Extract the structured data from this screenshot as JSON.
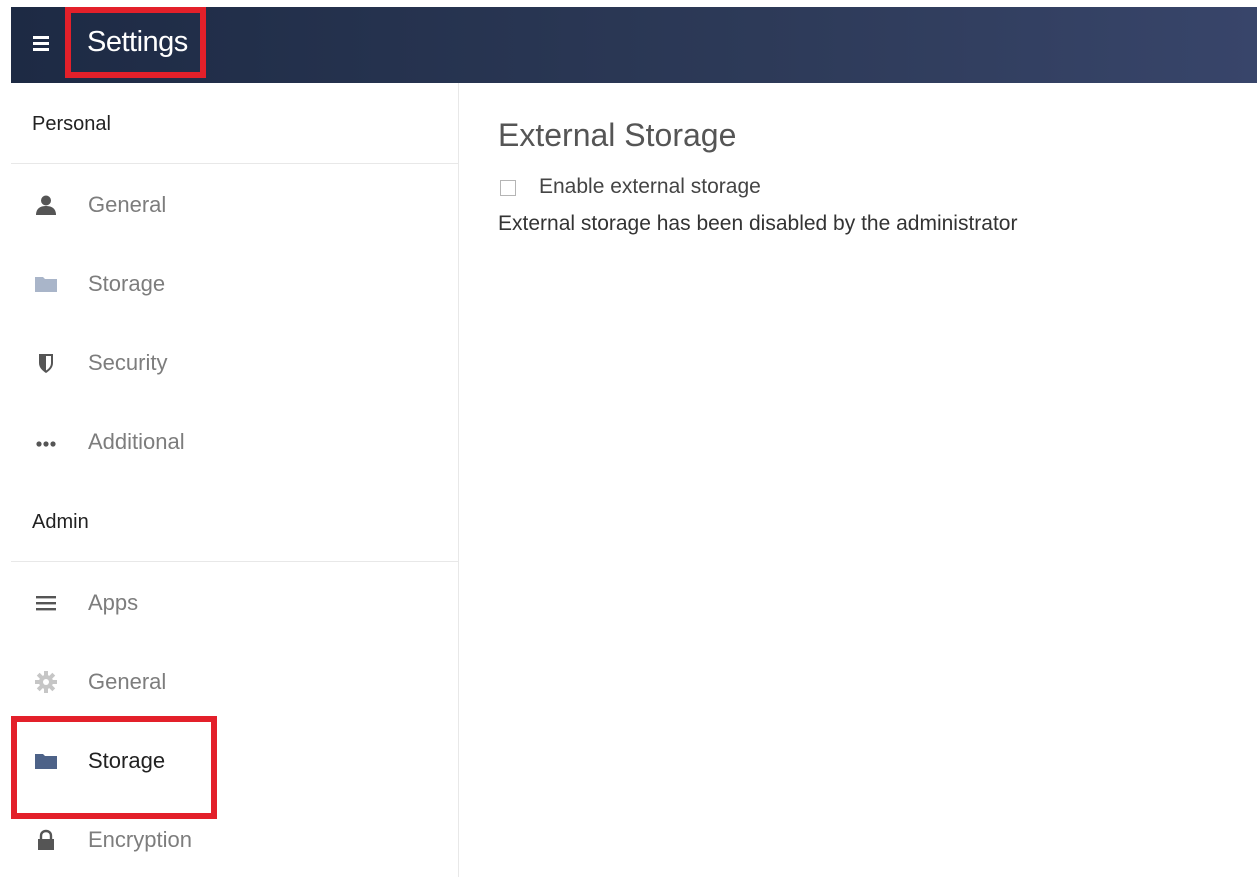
{
  "header": {
    "title": "Settings",
    "menu_icon": "hamburger-menu-icon"
  },
  "sidebar": {
    "personal": {
      "title": "Personal",
      "items": [
        {
          "label": "General",
          "icon": "user-icon"
        },
        {
          "label": "Storage",
          "icon": "folder-icon"
        },
        {
          "label": "Security",
          "icon": "shield-icon"
        },
        {
          "label": "Additional",
          "icon": "more-dots-icon"
        }
      ]
    },
    "admin": {
      "title": "Admin",
      "items": [
        {
          "label": "Apps",
          "icon": "list-icon"
        },
        {
          "label": "General",
          "icon": "gear-icon"
        },
        {
          "label": "Storage",
          "icon": "folder-icon",
          "active": true
        },
        {
          "label": "Encryption",
          "icon": "lock-icon"
        }
      ]
    }
  },
  "main": {
    "heading": "External Storage",
    "checkbox_label": "Enable external storage",
    "checkbox_checked": false,
    "info": "External storage has been disabled by the administrator"
  },
  "colors": {
    "header_bg": "#2d3a58",
    "highlight": "#e3202a",
    "active_folder": "#4d6288",
    "inactive_folder": "#a9b5c9"
  }
}
